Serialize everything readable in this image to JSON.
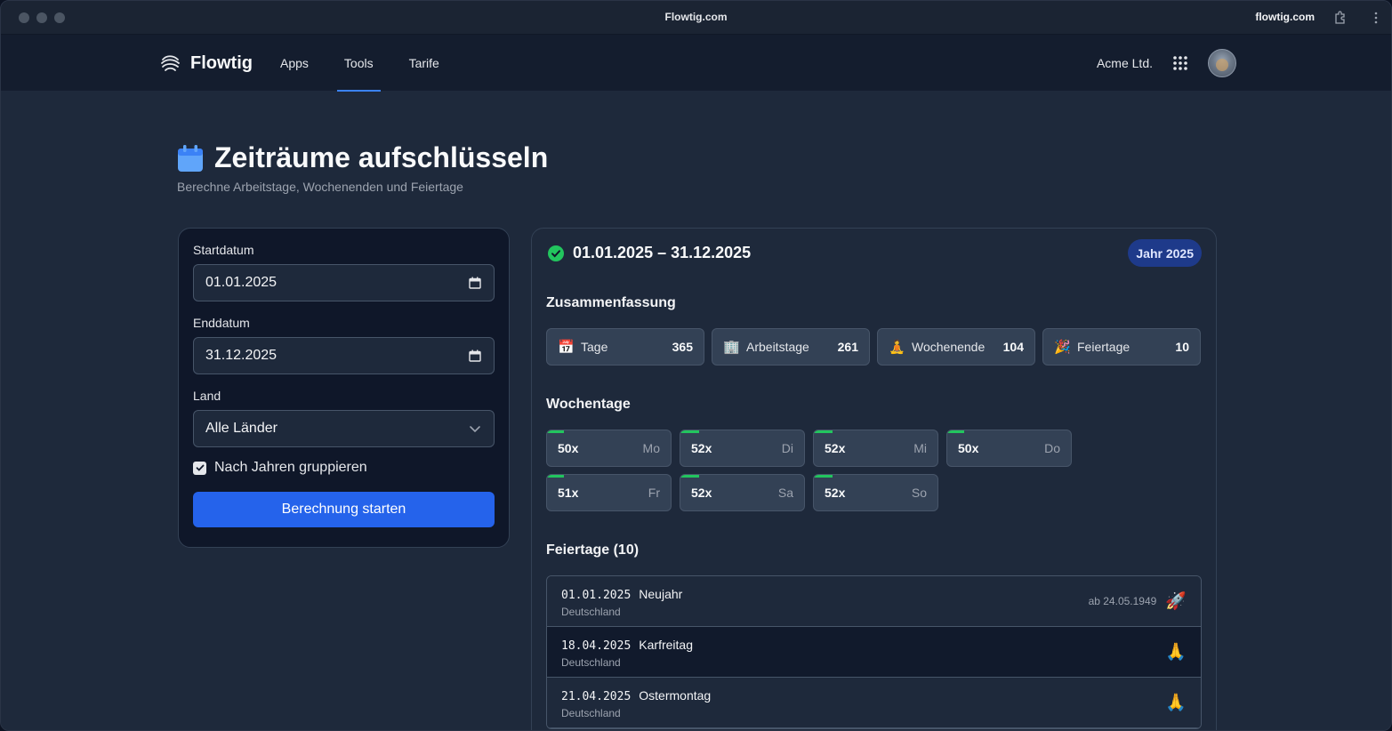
{
  "browser": {
    "title": "Flowtig.com",
    "domain": "flowtig.com"
  },
  "nav": {
    "brand": "Flowtig",
    "links": [
      {
        "label": "Apps",
        "active": false
      },
      {
        "label": "Tools",
        "active": true
      },
      {
        "label": "Tarife",
        "active": false
      }
    ],
    "org": "Acme Ltd."
  },
  "page": {
    "title": "Zeiträume aufschlüsseln",
    "subtitle": "Berechne Arbeitstage, Wochenenden und Feiertage"
  },
  "form": {
    "start_label": "Startdatum",
    "start_value": "01.01.2025",
    "end_label": "Enddatum",
    "end_value": "31.12.2025",
    "country_label": "Land",
    "country_value": "Alle Länder",
    "group_label": "Nach Jahren gruppieren",
    "group_checked": true,
    "submit_label": "Berechnung starten"
  },
  "result": {
    "range": "01.01.2025 – 31.12.2025",
    "year_badge": "Jahr 2025",
    "summary_title": "Zusammenfassung",
    "stats": [
      {
        "emoji": "📅",
        "label": "Tage",
        "value": "365"
      },
      {
        "emoji": "🏢",
        "label": "Arbeitstage",
        "value": "261"
      },
      {
        "emoji": "🧘",
        "label": "Wochenende",
        "value": "104"
      },
      {
        "emoji": "🎉",
        "label": "Feiertage",
        "value": "10"
      }
    ],
    "weekdays_title": "Wochentage",
    "weekdays": [
      {
        "count": "50x",
        "day": "Mo",
        "fraction": 0.14
      },
      {
        "count": "52x",
        "day": "Di",
        "fraction": 0.15
      },
      {
        "count": "52x",
        "day": "Mi",
        "fraction": 0.15
      },
      {
        "count": "50x",
        "day": "Do",
        "fraction": 0.14
      },
      {
        "count": "51x",
        "day": "Fr",
        "fraction": 0.14
      },
      {
        "count": "52x",
        "day": "Sa",
        "fraction": 0.15
      },
      {
        "count": "52x",
        "day": "So",
        "fraction": 0.15
      }
    ],
    "holidays_title": "Feiertage (10)",
    "holidays": [
      {
        "date": "01.01.2025",
        "name": "Neujahr",
        "country": "Deutschland",
        "since": "ab 24.05.1949",
        "emoji": "🚀"
      },
      {
        "date": "18.04.2025",
        "name": "Karfreitag",
        "country": "Deutschland",
        "since": "",
        "emoji": "🙏"
      },
      {
        "date": "21.04.2025",
        "name": "Ostermontag",
        "country": "Deutschland",
        "since": "",
        "emoji": "🙏"
      }
    ]
  },
  "colors": {
    "accent": "#2563eb",
    "success": "#22c55e",
    "badge": "#1e3a8a"
  }
}
